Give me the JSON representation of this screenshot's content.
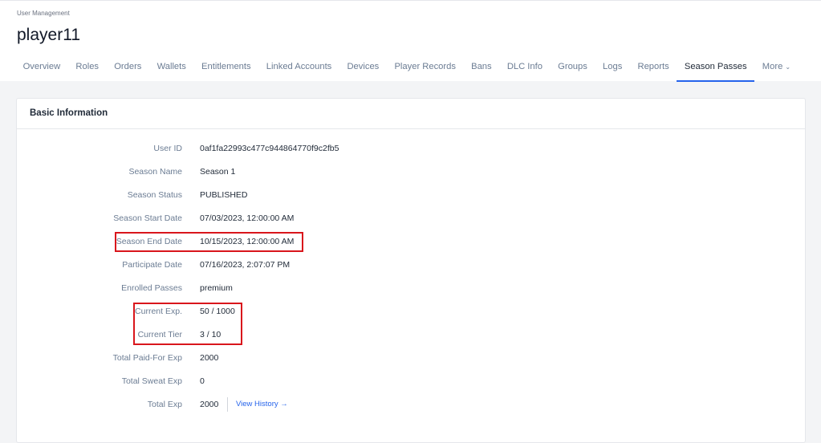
{
  "breadcrumb": "User Management",
  "title": "player11",
  "tabs": [
    "Overview",
    "Roles",
    "Orders",
    "Wallets",
    "Entitlements",
    "Linked Accounts",
    "Devices",
    "Player Records",
    "Bans",
    "DLC Info",
    "Groups",
    "Logs",
    "Reports",
    "Season Passes",
    "More"
  ],
  "active_tab": "Season Passes",
  "card": {
    "title": "Basic Information",
    "rows": [
      {
        "label": "User ID",
        "value": "0af1fa22993c477c944864770f9c2fb5"
      },
      {
        "label": "Season Name",
        "value": "Season 1"
      },
      {
        "label": "Season Status",
        "value": "PUBLISHED"
      },
      {
        "label": "Season Start Date",
        "value": "07/03/2023, 12:00:00 AM"
      },
      {
        "label": "Season End Date",
        "value": "10/15/2023, 12:00:00 AM"
      },
      {
        "label": "Participate Date",
        "value": "07/16/2023, 2:07:07 PM"
      },
      {
        "label": "Enrolled Passes",
        "value": "premium"
      },
      {
        "label": "Current Exp.",
        "value": "50 / 1000"
      },
      {
        "label": "Current Tier",
        "value": "3 / 10"
      },
      {
        "label": "Total Paid-For Exp",
        "value": "2000"
      },
      {
        "label": "Total Sweat Exp",
        "value": "0"
      },
      {
        "label": "Total Exp",
        "value": "2000"
      }
    ],
    "view_history": "View History →"
  },
  "colors": {
    "accent": "#2563eb",
    "highlight": "#d9161c"
  }
}
